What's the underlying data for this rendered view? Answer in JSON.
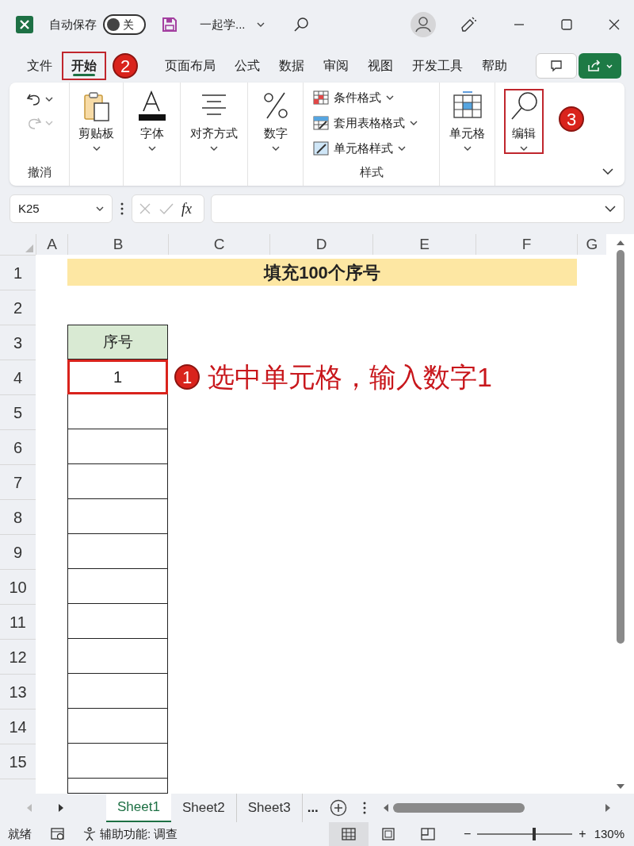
{
  "title_bar": {
    "autosave_label": "自动保存",
    "autosave": {
      "on": false,
      "label": "关"
    },
    "document_title": "一起学..."
  },
  "ribbon_tabs": [
    {
      "label": "文件",
      "selected": false,
      "highlighted": false
    },
    {
      "label": "开始",
      "selected": true,
      "highlighted": true,
      "callout": "2"
    },
    {
      "label": "页面布局",
      "selected": false,
      "highlighted": false
    },
    {
      "label": "公式",
      "selected": false,
      "highlighted": false
    },
    {
      "label": "数据",
      "selected": false,
      "highlighted": false
    },
    {
      "label": "审阅",
      "selected": false,
      "highlighted": false
    },
    {
      "label": "视图",
      "selected": false,
      "highlighted": false
    },
    {
      "label": "开发工具",
      "selected": false,
      "highlighted": false
    },
    {
      "label": "帮助",
      "selected": false,
      "highlighted": false
    }
  ],
  "ribbon_groups": [
    {
      "kind": "undo",
      "label": "撤消",
      "undo": {
        "disabled": false
      },
      "redo": {
        "disabled": true
      }
    },
    {
      "kind": "clipboard",
      "button": "剪贴板"
    },
    {
      "kind": "font",
      "button": "字体"
    },
    {
      "kind": "alignment",
      "button": "对齐方式"
    },
    {
      "kind": "number",
      "button": "数字"
    },
    {
      "kind": "styles",
      "label": "样式",
      "items": [
        "条件格式",
        "套用表格格式",
        "单元格样式"
      ]
    },
    {
      "kind": "cells",
      "button": "单元格"
    },
    {
      "kind": "editing",
      "button": "编辑",
      "highlighted": true,
      "callout": "3"
    }
  ],
  "formula_bar": {
    "name_box": "K25",
    "function_button": "fx"
  },
  "sheet": {
    "columns": [
      "A",
      "B",
      "C",
      "D",
      "E",
      "F",
      "G"
    ],
    "rows": [
      "1",
      "2",
      "3",
      "4",
      "5",
      "6",
      "7",
      "8",
      "9",
      "10",
      "11",
      "12",
      "13",
      "14",
      "15"
    ],
    "title": "填充100个序号",
    "table": {
      "header": "序号",
      "cells": [
        {
          "value": "1",
          "highlighted": true,
          "callout": "1",
          "note": "选中单元格，输入数字1"
        }
      ]
    }
  },
  "sheet_tabs": [
    {
      "label": "Sheet1",
      "selected": true
    },
    {
      "label": "Sheet2",
      "selected": false
    },
    {
      "label": "Sheet3",
      "selected": false
    }
  ],
  "more_sheets": "...",
  "status_bar": {
    "ready": "就绪",
    "accessibility": "辅助功能: 调查",
    "views": [
      {
        "kind": "normal",
        "selected": true
      },
      {
        "kind": "page_layout",
        "selected": false
      },
      {
        "kind": "page_break",
        "selected": false
      }
    ],
    "zoom_out": "−",
    "zoom_in": "+",
    "zoom": {
      "level": 0.6,
      "text": "130%"
    }
  }
}
